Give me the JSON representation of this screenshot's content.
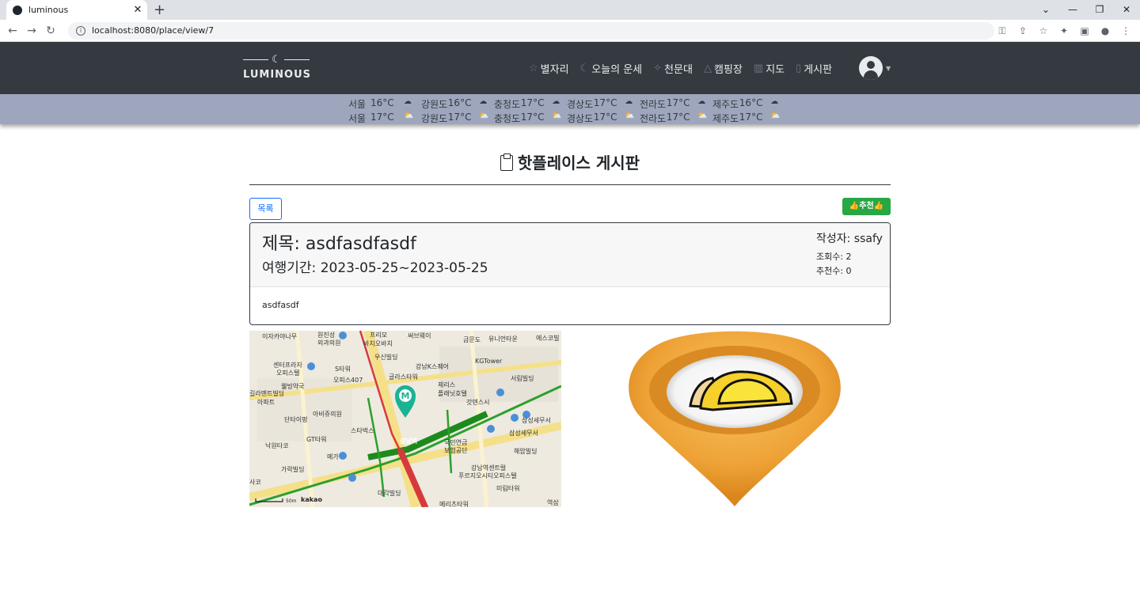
{
  "browser": {
    "tab_title": "luminous",
    "url": "localhost:8080/place/view/7"
  },
  "nav": {
    "logo_text": "LUMINOUS",
    "menu": [
      {
        "label": "별자리",
        "icon": "star-icon"
      },
      {
        "label": "오늘의 운세",
        "icon": "moon-icon"
      },
      {
        "label": "천문대",
        "icon": "sparkle-icon"
      },
      {
        "label": "캠핑장",
        "icon": "tent-icon"
      },
      {
        "label": "지도",
        "icon": "map-icon"
      },
      {
        "label": "게시판",
        "icon": "clipboard-icon"
      }
    ]
  },
  "weather": {
    "row1": [
      {
        "region": "서울",
        "temp": "16°C",
        "icon": "cloud-icon"
      },
      {
        "region": "강원도",
        "temp": "16°C",
        "icon": "cloud-icon"
      },
      {
        "region": "충청도",
        "temp": "17°C",
        "icon": "cloud-icon"
      },
      {
        "region": "경상도",
        "temp": "17°C",
        "icon": "cloud-icon"
      },
      {
        "region": "전라도",
        "temp": "17°C",
        "icon": "cloud-icon"
      },
      {
        "region": "제주도",
        "temp": "16°C",
        "icon": "cloud-icon"
      }
    ],
    "row2": [
      {
        "region": "서울",
        "temp": "17°C",
        "icon": "partly-sunny-icon"
      },
      {
        "region": "강원도",
        "temp": "17°C",
        "icon": "partly-sunny-icon"
      },
      {
        "region": "충청도",
        "temp": "17°C",
        "icon": "partly-sunny-icon"
      },
      {
        "region": "경상도",
        "temp": "17°C",
        "icon": "partly-sunny-icon"
      },
      {
        "region": "전라도",
        "temp": "17°C",
        "icon": "partly-sunny-icon"
      },
      {
        "region": "제주도",
        "temp": "17°C",
        "icon": "partly-sunny-icon"
      }
    ]
  },
  "board": {
    "title": "핫플레이스 게시판",
    "list_button": "목록",
    "recommend_button": "👍추천👍"
  },
  "post": {
    "title": "제목: asdfasdfasdf",
    "period": "여행기간: 2023-05-25~2023-05-25",
    "writer": "작성자: ssafy",
    "views": "조회수: 2",
    "recommends": "추천수: 0",
    "content": "asdfasdf"
  },
  "map": {
    "labels": [
      "이자카야나무",
      "원진성",
      "외과의원",
      "프리모",
      "바치오바치",
      "써브웨이",
      "금문도",
      "유니언타운",
      "에스코빌",
      "센터프라자",
      "오피스텔",
      "S타워",
      "우신빌딩",
      "강남K스퀘어",
      "KGTower",
      "웰빙약국",
      "오피스407",
      "글라스타워",
      "제리스",
      "플래닛호텔",
      "서림빌딩",
      "길라멘트빌딩",
      "아파트",
      "아비쥬의원",
      "갓덴스시",
      "삼성세무서",
      "단타이펑",
      "스타벅스",
      "GT타워",
      "강남역",
      "국민연금",
      "보험공단",
      "삼성세무서",
      "낙원타코",
      "메가",
      "해암빌딩",
      "가락빌딩",
      "강남역센트럴",
      "푸르지오시티오피스텔",
      "미림타워",
      "대각빌딩",
      "메리츠타워",
      "역삼",
      "사코"
    ],
    "scale": "50m",
    "brand": "kakao"
  },
  "colors": {
    "navbar": "#343a40",
    "weather_bar": "#9ea6bd",
    "primary": "#0d6efd",
    "success": "#28a745",
    "pin_orange": "#f0a33a"
  }
}
